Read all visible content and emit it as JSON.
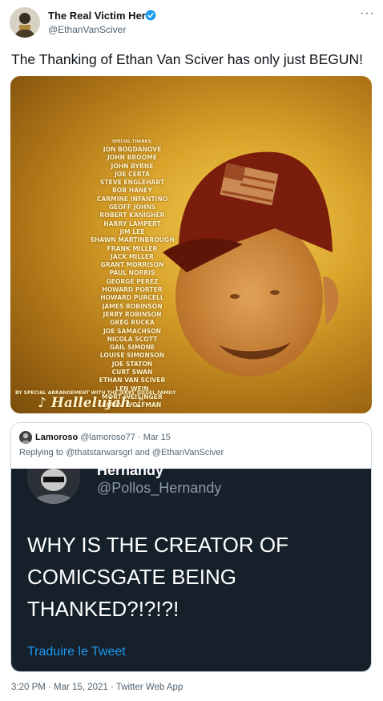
{
  "author": {
    "name": "The Real Victim Here",
    "handle": "@EthanVanSciver",
    "verified": true
  },
  "more_glyph": "···",
  "tweet_text": "The Thanking of Ethan Van Sciver has only just BEGUN!",
  "media": {
    "credits_header": "SPECIAL THANKS:",
    "credits": [
      "JON BOGDANOVE",
      "JOHN BROOME",
      "JOHN BYRNE",
      "JOE CERTA",
      "STEVE ENGLEHART",
      "BOB HANEY",
      "CARMINE INFANTINO",
      "GEOFF JOHNS",
      "ROBERT KANIGHER",
      "HARRY LAMPERT",
      "JIM LEE",
      "SHAWN MARTINBROUGH",
      "FRANK MILLER",
      "JACK MILLER",
      "GRANT MORRISON",
      "PAUL NORRIS",
      "GEORGE PEREZ",
      "HOWARD PORTER",
      "HOWARD PURCELL",
      "JAMES ROBINSON",
      "JERRY ROBINSON",
      "GREG RUCKA",
      "JOE SAMACHSON",
      "NICOLA SCOTT",
      "GAIL SIMONE",
      "LOUISE SIMONSON",
      "JOE STATON",
      "CURT SWAN",
      "ETHAN VAN SCIVER",
      "LEN WEIN",
      "MORT WEISINGER",
      "MARV WOLFMAN"
    ],
    "credits_footer": "BY SPECIAL ARRANGEMENT WITH THE JERRY SIEGEL FAMILY",
    "hallelujah": "♪ Hallelujah ♪"
  },
  "quoted": {
    "name": "Lamoroso",
    "handle": "@lamoroso77",
    "date": "· Mar 15",
    "replying_prefix": "Replying to",
    "replying_to": "@thatstarwarsgrl and @EthanVanSciver",
    "screenshot": {
      "name": "Hernandy",
      "handle": "@Pollos_Hernandy",
      "text": "WHY IS THE CREATOR OF COMICSGATE BEING THANKED?!?!?!",
      "translate": "Traduire le Tweet"
    }
  },
  "footer": "3:20 PM · Mar 15, 2021 · Twitter Web App",
  "colors": {
    "link": "#1d9bf0",
    "verified": "#1d9bf0",
    "dark_bg": "#15202b",
    "border": "#cfd9de"
  }
}
